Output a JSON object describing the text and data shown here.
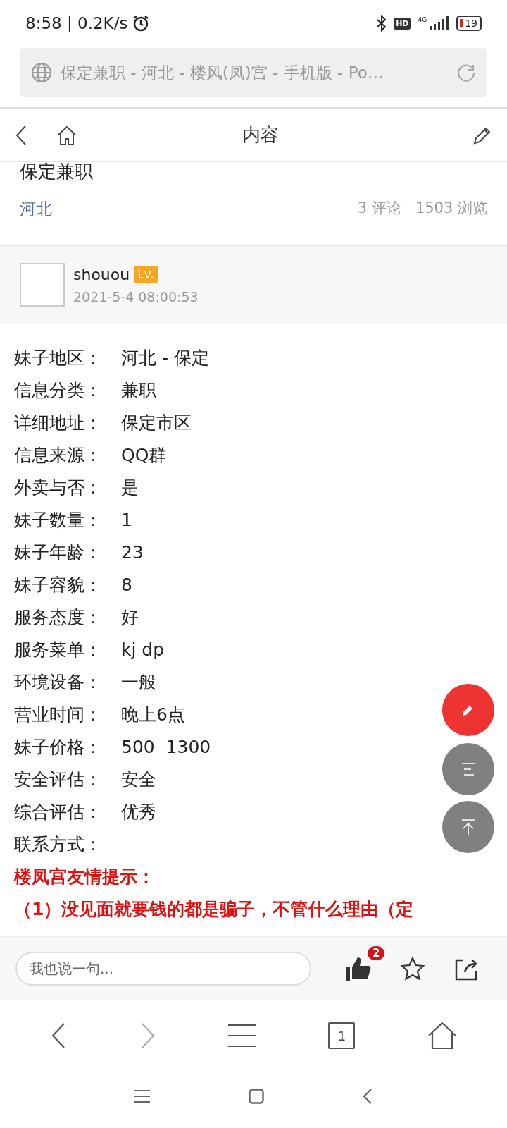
{
  "status_bar": {
    "time": "8:58 | 0.2K/s",
    "hd": "HD",
    "network": "4G",
    "battery": "19"
  },
  "address_bar": {
    "title": "保定兼职 - 河北 - 楼风(凤)宫 - 手机版 - Po…"
  },
  "header": {
    "title": "内容"
  },
  "post": {
    "title": "保定兼职",
    "region": "河北",
    "comments": "3 评论",
    "views": "1503 浏览"
  },
  "author": {
    "name": "shouou",
    "badge": "Lv.",
    "time": "2021-5-4 08:00:53"
  },
  "fields": [
    {
      "label": "妹子地区：",
      "value": "河北 - 保定"
    },
    {
      "label": "信息分类：",
      "value": "兼职"
    },
    {
      "label": "详细地址：",
      "value": "保定市区"
    },
    {
      "label": "信息来源：",
      "value": "QQ群"
    },
    {
      "label": "外卖与否：",
      "value": "是"
    },
    {
      "label": "妹子数量：",
      "value": "1"
    },
    {
      "label": "妹子年龄：",
      "value": "23"
    },
    {
      "label": "妹子容貌：",
      "value": "8"
    },
    {
      "label": "服务态度：",
      "value": "好"
    },
    {
      "label": "服务菜单：",
      "value": "kj dp"
    },
    {
      "label": "环境设备：",
      "value": "一般"
    },
    {
      "label": "营业时间：",
      "value": "晚上6点"
    },
    {
      "label": "妹子价格：",
      "value": "500  1300"
    },
    {
      "label": "安全评估：",
      "value": "安全"
    },
    {
      "label": "综合评估：",
      "value": "优秀"
    },
    {
      "label": "联系方式："
    }
  ],
  "notice": {
    "title": "楼凤宫友情提示：",
    "lines": [
      "（1）没见面就要钱的都是骗子，不管什么理由（定"
    ]
  },
  "comment_bar": {
    "placeholder": "我也说一句...",
    "likes": "2"
  },
  "browser_nav": {
    "tabs": "1"
  }
}
